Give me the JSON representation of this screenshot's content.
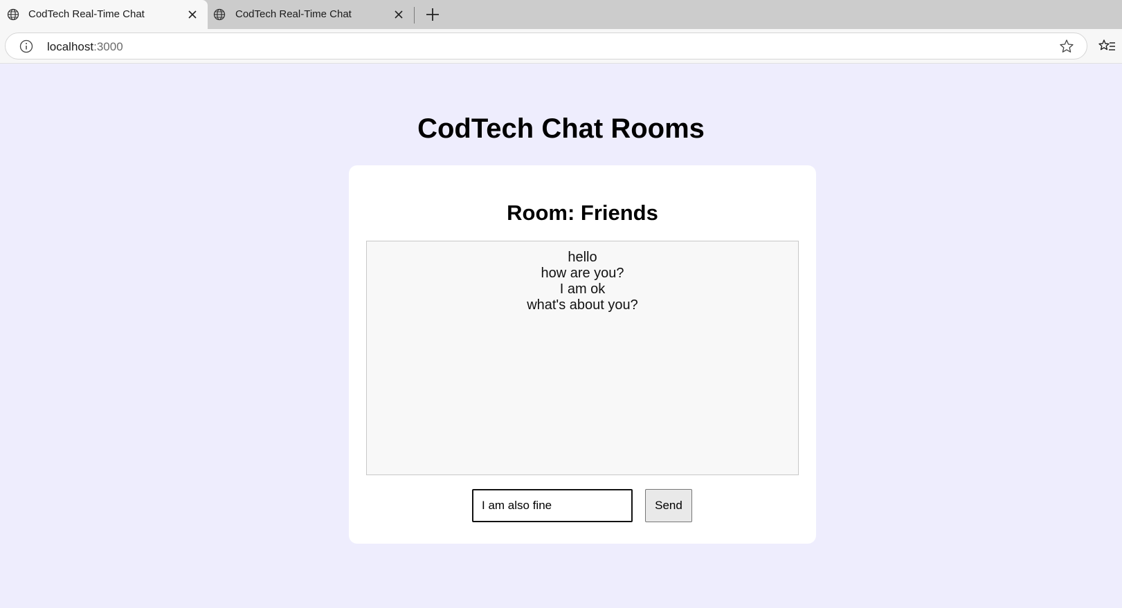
{
  "browser": {
    "tabs": [
      {
        "title": "CodTech Real-Time Chat",
        "active": true
      },
      {
        "title": "CodTech Real-Time Chat",
        "active": false
      }
    ],
    "url": {
      "host": "localhost",
      "port": ":3000"
    }
  },
  "page": {
    "title": "CodTech Chat Rooms",
    "room_title": "Room: Friends",
    "messages": [
      "hello",
      "how are you?",
      "I am ok",
      "what's about you?"
    ],
    "input_value": "I am also fine",
    "send_label": "Send"
  },
  "colors": {
    "page_background": "#eeedfd",
    "card_background": "#ffffff",
    "messages_background": "#f8f8f8"
  }
}
